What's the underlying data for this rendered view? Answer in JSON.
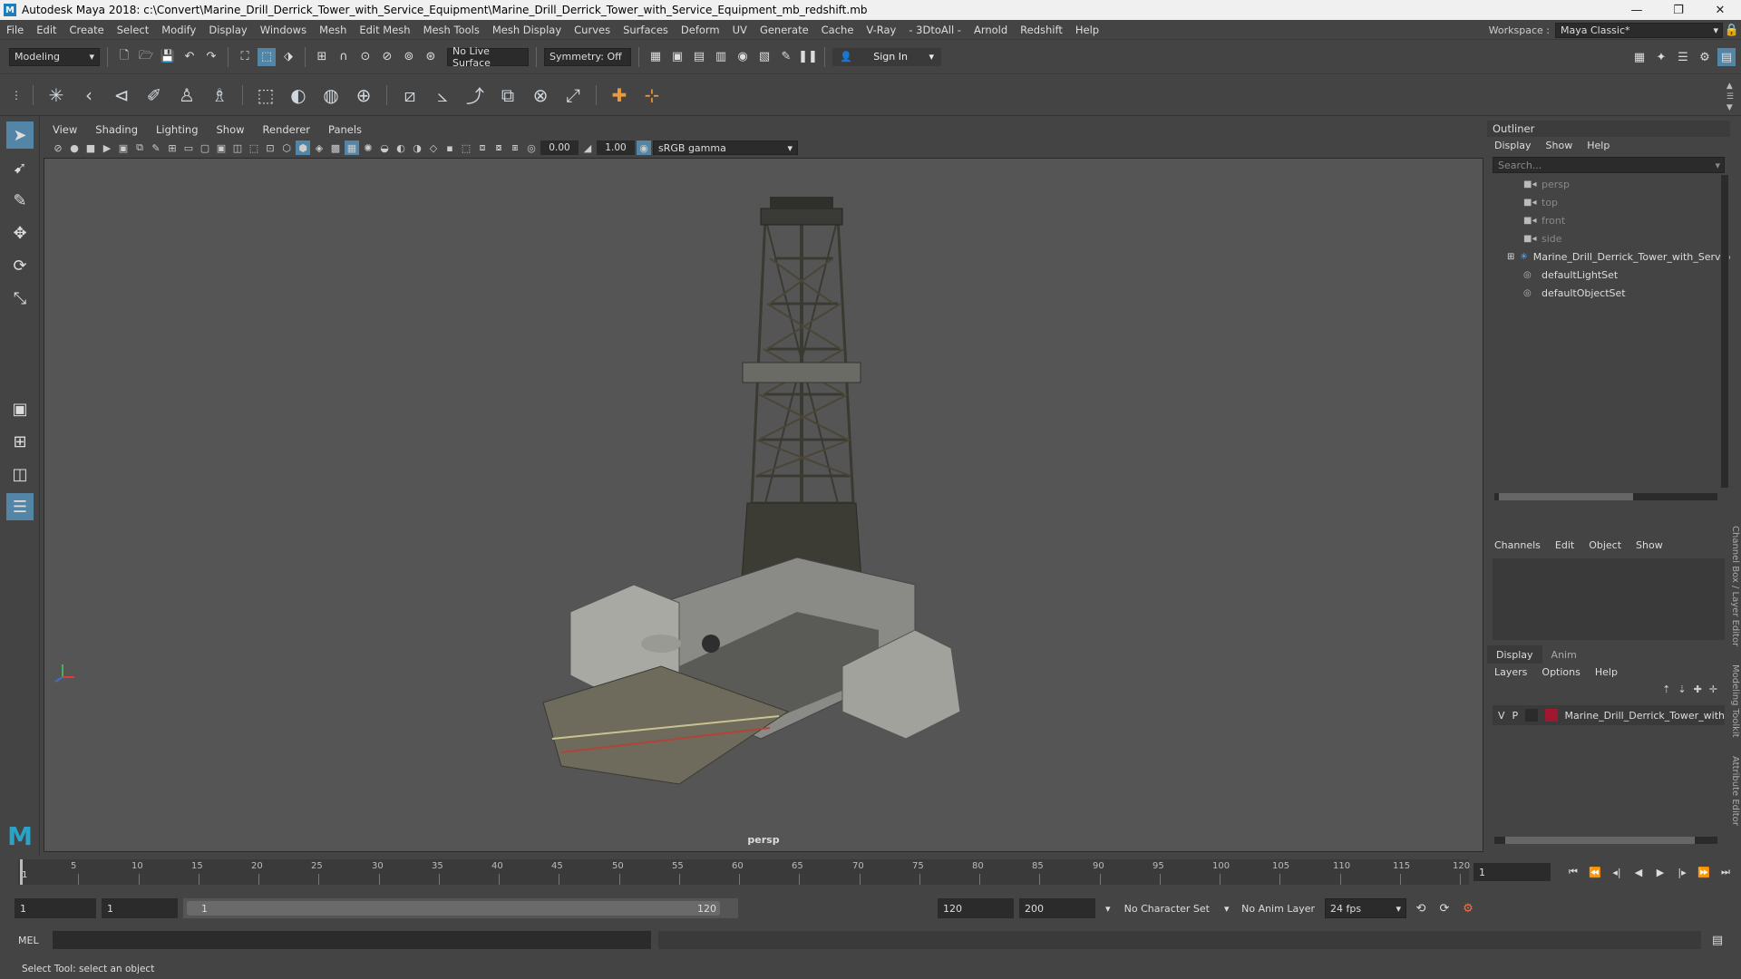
{
  "window": {
    "title": "Autodesk Maya 2018: c:\\Convert\\Marine_Drill_Derrick_Tower_with_Service_Equipment\\Marine_Drill_Derrick_Tower_with_Service_Equipment_mb_redshift.mb",
    "controls": [
      "—",
      "❐",
      "✕"
    ]
  },
  "menubar": {
    "items": [
      "File",
      "Edit",
      "Create",
      "Select",
      "Modify",
      "Display",
      "Windows",
      "Mesh",
      "Edit Mesh",
      "Mesh Tools",
      "Mesh Display",
      "Curves",
      "Surfaces",
      "Deform",
      "UV",
      "Generate",
      "Cache",
      "V-Ray",
      "- 3DtoAll -",
      "Arnold",
      "Redshift",
      "Help"
    ],
    "workspace_label": "Workspace :",
    "workspace_value": "Maya Classic*"
  },
  "statusline": {
    "mode": "Modeling",
    "live_surface": "No Live Surface",
    "symmetry": "Symmetry: Off",
    "sign_in": "Sign In"
  },
  "viewport": {
    "menu": [
      "View",
      "Shading",
      "Lighting",
      "Show",
      "Renderer",
      "Panels"
    ],
    "exposure": "0.00",
    "gamma": "1.00",
    "color_space": "sRGB gamma",
    "camera_label": "persp"
  },
  "outliner": {
    "title": "Outliner",
    "menu": [
      "Display",
      "Show",
      "Help"
    ],
    "search_placeholder": "Search...",
    "items": [
      {
        "label": "persp",
        "dim": true
      },
      {
        "label": "top",
        "dim": true
      },
      {
        "label": "front",
        "dim": true
      },
      {
        "label": "side",
        "dim": true
      },
      {
        "label": "Marine_Drill_Derrick_Tower_with_Service",
        "dim": false
      },
      {
        "label": "defaultLightSet",
        "dim": false
      },
      {
        "label": "defaultObjectSet",
        "dim": false
      }
    ]
  },
  "channelbox": {
    "menu": [
      "Channels",
      "Edit",
      "Object",
      "Show"
    ]
  },
  "layers": {
    "tabs": [
      "Display",
      "Anim"
    ],
    "menu": [
      "Layers",
      "Options",
      "Help"
    ],
    "row": {
      "v": "V",
      "p": "P",
      "name": "Marine_Drill_Derrick_Tower_with"
    }
  },
  "side_tabs": [
    "Channel Box / Layer Editor",
    "Modeling Toolkit",
    "Attribute Editor"
  ],
  "timeline": {
    "ticks": [
      "5",
      "10",
      "15",
      "20",
      "25",
      "30",
      "35",
      "40",
      "45",
      "50",
      "55",
      "60",
      "65",
      "70",
      "75",
      "80",
      "85",
      "90",
      "95",
      "100",
      "105",
      "110",
      "115",
      "120"
    ],
    "start_marker": "1",
    "current_frame": "1"
  },
  "range": {
    "start": "1",
    "playback_start": "1",
    "slider_start": "1",
    "slider_end": "120",
    "playback_end": "120",
    "end": "200",
    "character_set": "No Character Set",
    "anim_layer": "No Anim Layer",
    "fps": "24 fps"
  },
  "cmdline": {
    "label": "MEL"
  },
  "helpline": {
    "text": "Select Tool: select an object"
  }
}
